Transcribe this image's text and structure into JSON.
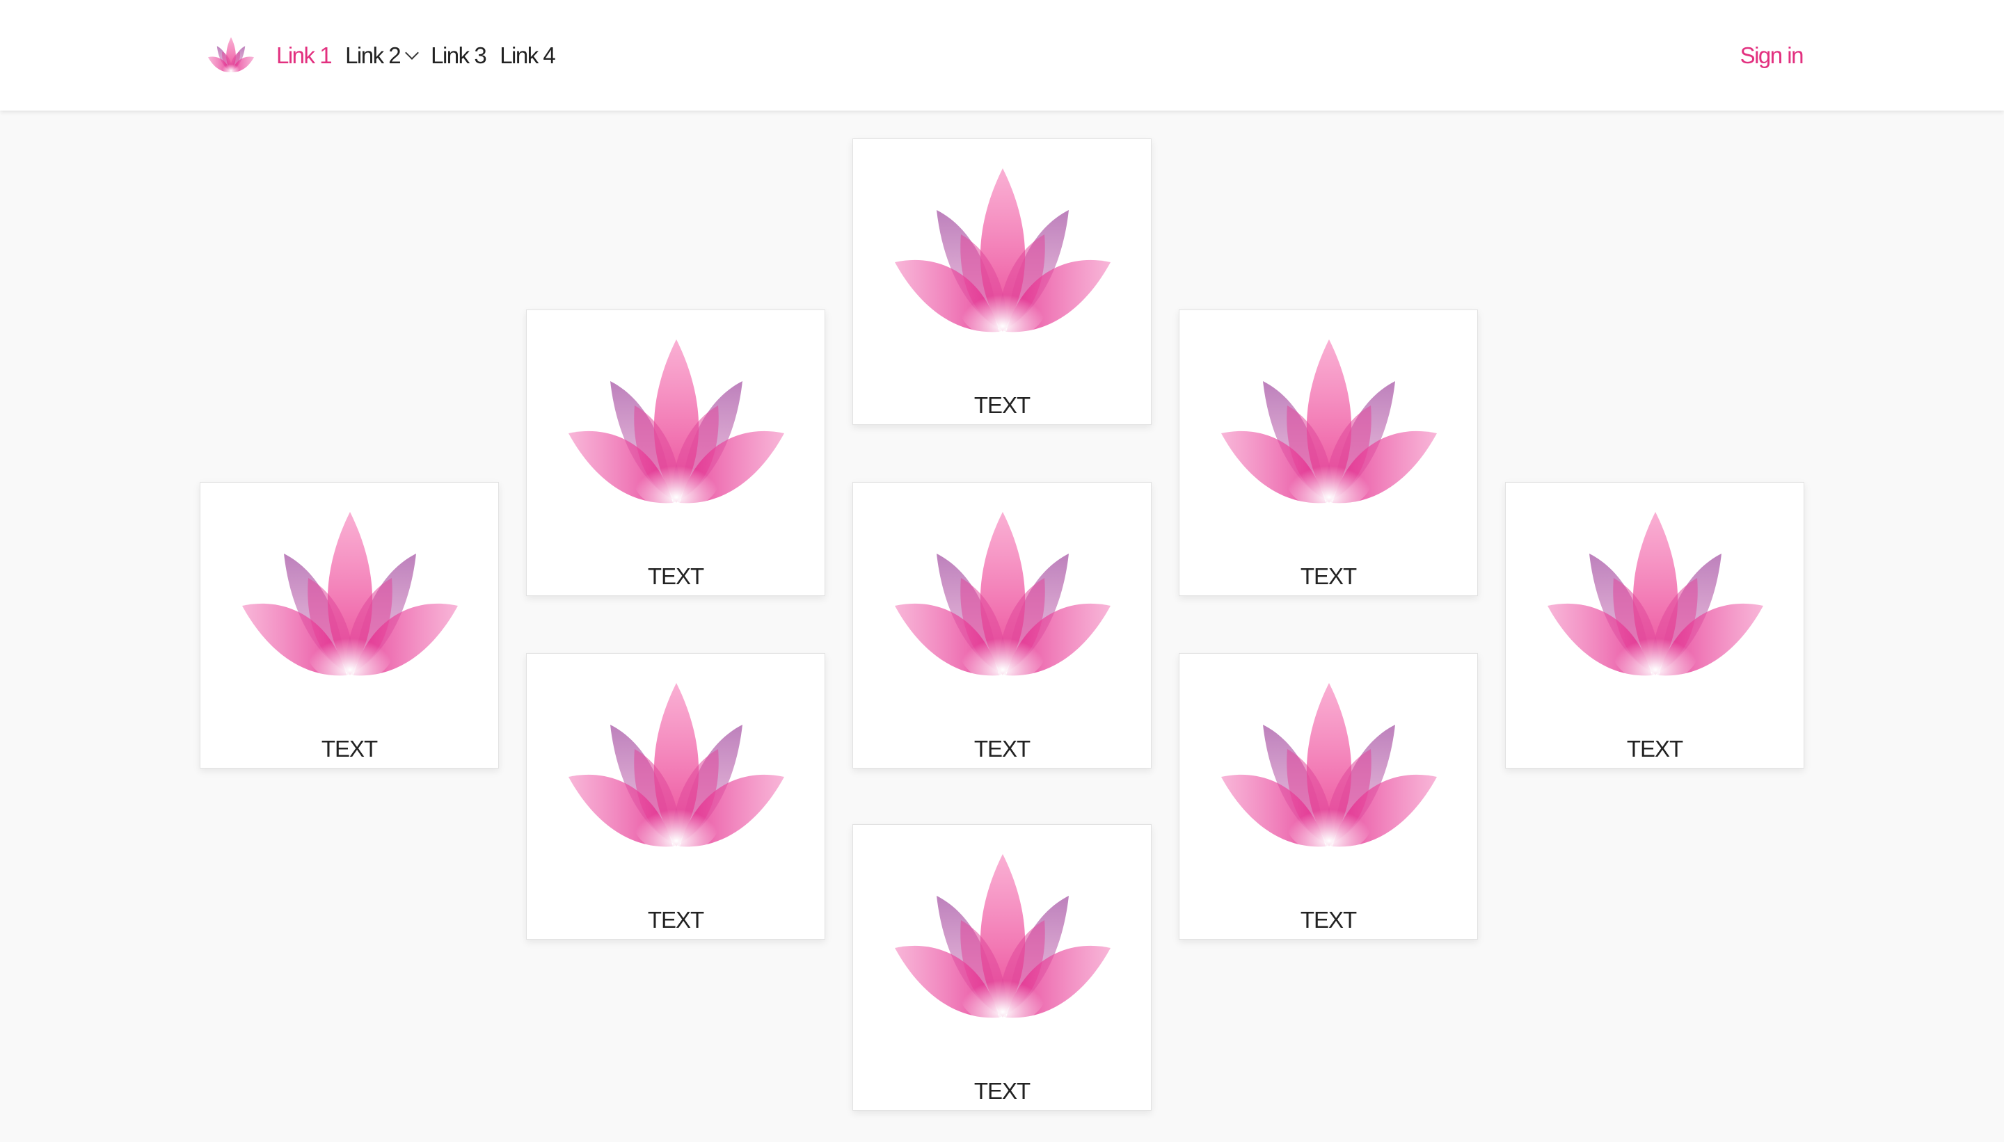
{
  "navbar": {
    "logo_icon": "lotus-icon",
    "links": [
      {
        "label": "Link 1",
        "active": true
      },
      {
        "label": "Link 2",
        "dropdown": true
      },
      {
        "label": "Link 3"
      },
      {
        "label": "Link 4"
      }
    ],
    "sign_in": "Sign in"
  },
  "tiles": [
    {
      "label": "TEXT",
      "icon": "lotus-icon"
    },
    {
      "label": "TEXT",
      "icon": "lotus-icon"
    },
    {
      "label": "TEXT",
      "icon": "lotus-icon"
    },
    {
      "label": "TEXT",
      "icon": "lotus-icon"
    },
    {
      "label": "TEXT",
      "icon": "lotus-icon"
    },
    {
      "label": "TEXT",
      "icon": "lotus-icon"
    },
    {
      "label": "TEXT",
      "icon": "lotus-icon"
    },
    {
      "label": "TEXT",
      "icon": "lotus-icon"
    },
    {
      "label": "TEXT",
      "icon": "lotus-icon"
    }
  ],
  "colors": {
    "accent": "#e2307f",
    "text": "#222222",
    "background": "#f9f9f9",
    "lotus_pink": "#ee3e96",
    "lotus_purple": "#9b3f9b"
  }
}
